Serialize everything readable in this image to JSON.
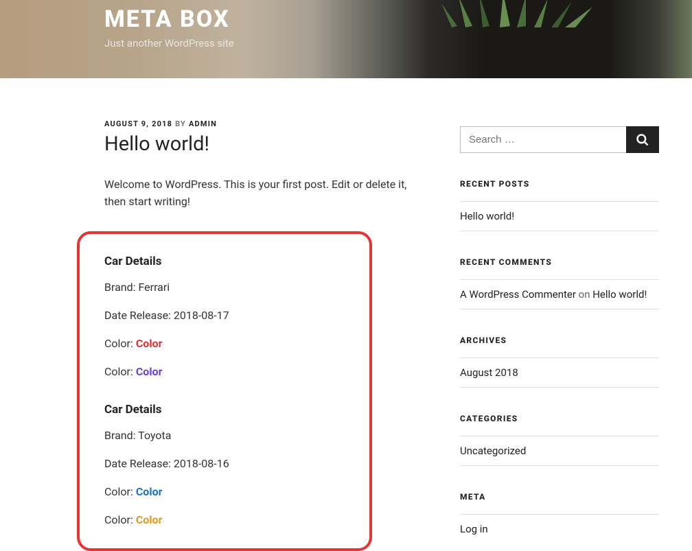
{
  "hero": {
    "title": "META BOX",
    "tagline": "Just another WordPress site"
  },
  "post": {
    "date": "AUGUST 9, 2018",
    "by_label": "BY",
    "author": "ADMIN",
    "title": "Hello world!",
    "intro": "Welcome to WordPress. This is your first post. Edit or delete it, then start writing!"
  },
  "cars": [
    {
      "heading": "Car Details",
      "brand_label": "Brand: ",
      "brand": "Ferrari",
      "date_label": "Date Release: ",
      "date": "2018-08-17",
      "colors": [
        {
          "label": "Color: ",
          "text": "Color",
          "hex": "#d63638"
        },
        {
          "label": "Color: ",
          "text": "Color",
          "hex": "#6b3fe0"
        }
      ]
    },
    {
      "heading": "Car Details",
      "brand_label": "Brand: ",
      "brand": "Toyota",
      "date_label": "Date Release: ",
      "date": "2018-08-16",
      "colors": [
        {
          "label": "Color: ",
          "text": "Color",
          "hex": "#1e73be"
        },
        {
          "label": "Color: ",
          "text": "Color",
          "hex": "#e09b1f"
        }
      ]
    }
  ],
  "sidebar": {
    "search_placeholder": "Search …",
    "widgets": {
      "recent_posts": {
        "title": "RECENT POSTS",
        "items": [
          "Hello world!"
        ]
      },
      "recent_comments": {
        "title": "RECENT COMMENTS",
        "commenter": "A WordPress Commenter",
        "on_label": " on ",
        "target": "Hello world!"
      },
      "archives": {
        "title": "ARCHIVES",
        "items": [
          "August 2018"
        ]
      },
      "categories": {
        "title": "CATEGORIES",
        "items": [
          "Uncategorized"
        ]
      },
      "meta": {
        "title": "META",
        "items": [
          "Log in"
        ]
      }
    }
  }
}
